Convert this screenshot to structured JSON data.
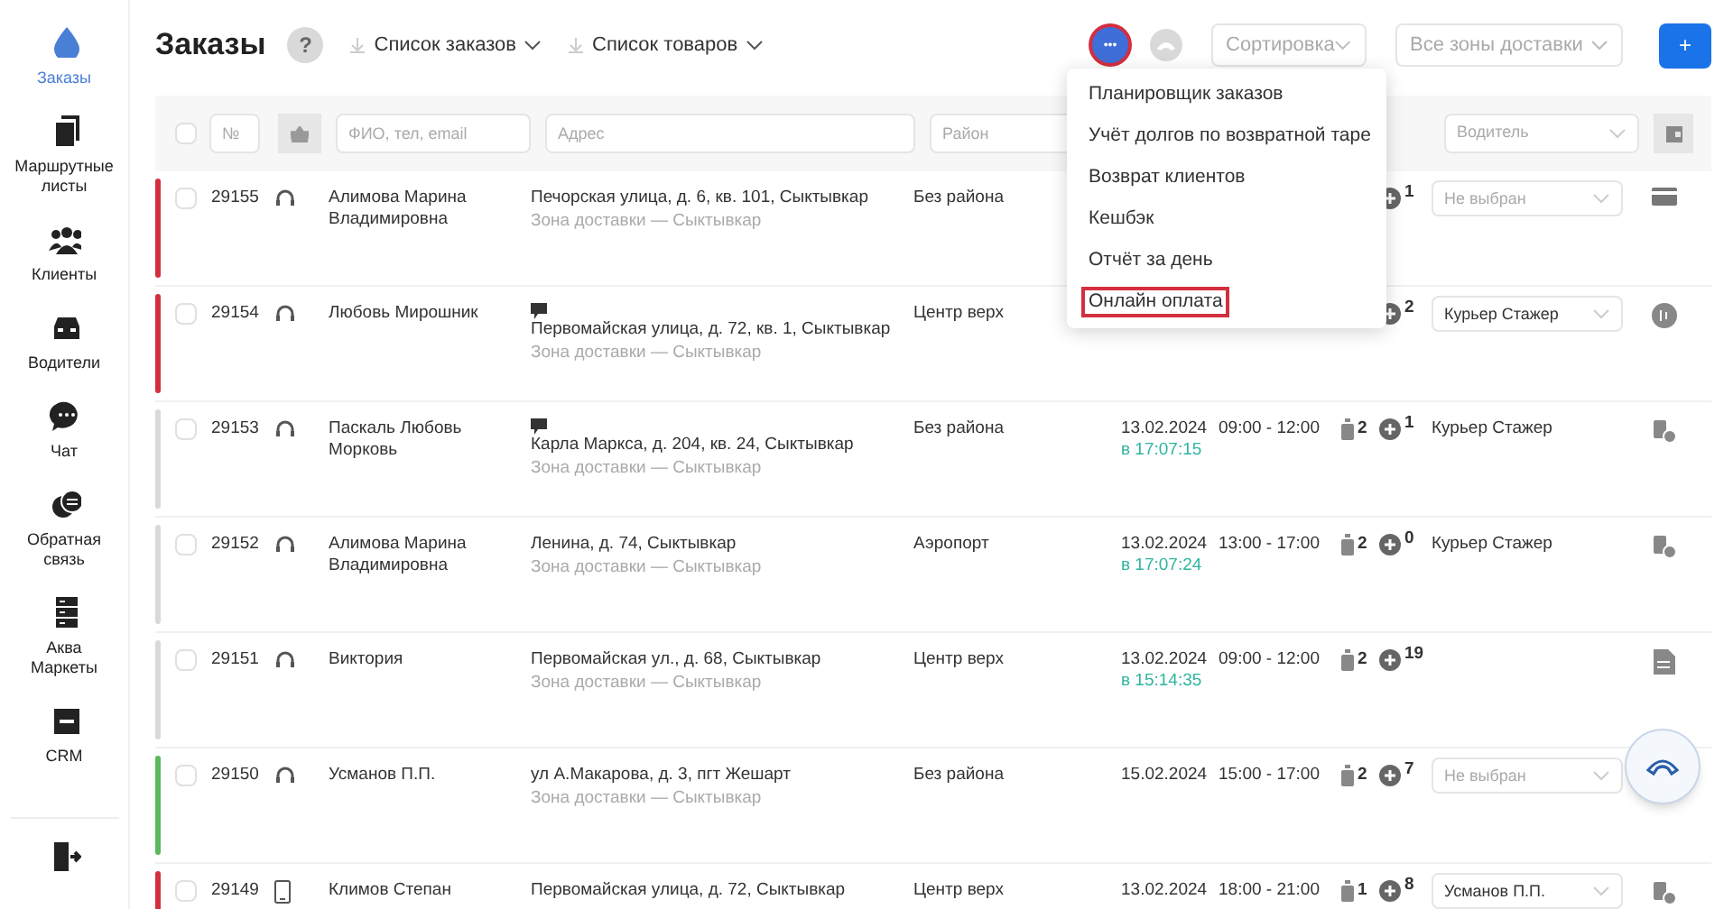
{
  "sidebar": {
    "items": [
      {
        "label": "Заказы",
        "selected": true
      },
      {
        "label": "Маршрутные листы",
        "selected": false
      },
      {
        "label": "Клиенты",
        "selected": false
      },
      {
        "label": "Водители",
        "selected": false
      },
      {
        "label": "Чат",
        "selected": false
      },
      {
        "label": "Обратная связь",
        "selected": false
      },
      {
        "label": "Аква Маркеты",
        "selected": false
      },
      {
        "label": "CRM",
        "selected": false
      }
    ]
  },
  "header": {
    "title": "Заказы",
    "help": "?",
    "exports": [
      "Список заказов",
      "Список товаров"
    ],
    "more": "•••",
    "sort": "Сортировка",
    "zones": "Все зоны доставки",
    "add": "+"
  },
  "more_menu": [
    {
      "label": "Планировщик заказов",
      "highlighted": false
    },
    {
      "label": "Учёт долгов по возвратной таре",
      "highlighted": false
    },
    {
      "label": "Возврат клиентов",
      "highlighted": false
    },
    {
      "label": "Кешбэк",
      "highlighted": false
    },
    {
      "label": "Отчёт за день",
      "highlighted": false
    },
    {
      "label": "Онлайн оплата",
      "highlighted": true
    }
  ],
  "filters": {
    "select_all": {
      "checked": false
    },
    "number": {
      "placeholder": "№"
    },
    "client": {
      "placeholder": "ФИО, тел, email"
    },
    "address": {
      "placeholder": "Адрес"
    },
    "district": {
      "placeholder": "Район"
    },
    "driver": {
      "placeholder": "Водитель"
    }
  },
  "rows": [
    {
      "kind": "headset",
      "checked": false,
      "number": "29155",
      "color": "#d32f3f",
      "name": "Алимова Марина Владимировна",
      "comment": false,
      "address": "Печорская улица, д. 6, кв. 101, Сыктывкар",
      "zone": "Зона доставки — Сыктывкар",
      "district": "Без района",
      "extra": "1",
      "driver": {
        "kind": "select",
        "placeholder": "Не выбран"
      }
    },
    {
      "kind": "headset",
      "checked": false,
      "number": "29154",
      "color": "#d32f3f",
      "name": "Любовь Мирошник",
      "comment": true,
      "address": "Первомайская улица, д. 72, кв. 1, Сыктывкар",
      "zone": "Зона доставки — Сыктывкар",
      "district": "Центр верх",
      "extra": "2",
      "driver": {
        "kind": "select",
        "value": "Курьер Стажер"
      }
    },
    {
      "kind": "headset",
      "checked": false,
      "number": "29153",
      "color": "#d9d9d9",
      "name": "Паскаль Любовь Морковь",
      "comment": true,
      "address": "Карла Маркса, д. 204, кв. 24, Сыктывкар",
      "zone": "Зона доставки — Сыктывкар",
      "district": "Без района",
      "date": "13.02.2024",
      "paid": "в 17:07:15",
      "time": "09:00 - 12:00",
      "bottles": "2",
      "extra": "1",
      "driver": {
        "kind": "text",
        "value": "Курьер Стажер"
      }
    },
    {
      "kind": "headset",
      "checked": false,
      "number": "29152",
      "color": "#d9d9d9",
      "name": "Алимова Марина Владимировна",
      "comment": false,
      "address": "Ленина, д. 74, Сыктывкар",
      "zone": "Зона доставки — Сыктывкар",
      "district": "Аэропорт",
      "date": "13.02.2024",
      "paid": "в 17:07:24",
      "time": "13:00 - 17:00",
      "bottles": "2",
      "extra": "0",
      "driver": {
        "kind": "text",
        "value": "Курьер Стажер"
      }
    },
    {
      "kind": "headset",
      "checked": false,
      "number": "29151",
      "color": "#d9d9d9",
      "name": "Виктория",
      "comment": false,
      "address": "Первомайская ул., д. 68, Сыктывкар",
      "zone": "Зона доставки — Сыктывкар",
      "district": "Центр верх",
      "date": "13.02.2024",
      "paid": "в 15:14:35",
      "time": "09:00 - 12:00",
      "bottles": "2",
      "extra": "19",
      "driver": {
        "kind": "none"
      }
    },
    {
      "kind": "headset",
      "checked": false,
      "number": "29150",
      "color": "#5cb85c",
      "name": "Усманов П.П.",
      "comment": false,
      "address": "ул А.Макарова, д. 3, пгт Жешарт",
      "zone": "Зона доставки — Сыктывкар",
      "district": "Без района",
      "date": "15.02.2024",
      "time": "15:00 - 17:00",
      "bottles": "2",
      "extra": "7",
      "driver": {
        "kind": "select",
        "placeholder": "Не выбран"
      }
    },
    {
      "kind": "phone",
      "checked": false,
      "number": "29149",
      "color": "#d32f3f",
      "name": "Климов Степан",
      "comment": false,
      "address": "Первомайская улица, д. 72, Сыктывкар",
      "district": "Центр верх",
      "date": "13.02.2024",
      "time": "18:00 - 21:00",
      "bottles": "1",
      "extra": "8",
      "driver": {
        "kind": "select",
        "value": "Усманов П.П."
      }
    }
  ]
}
